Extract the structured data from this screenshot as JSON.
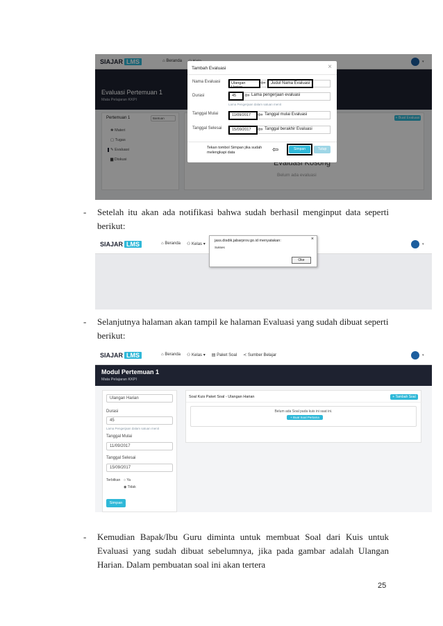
{
  "paragraphs": [
    "Setelah itu akan ada notifikasi bahwa sudah berhasil menginput data seperti berikut:",
    "Selanjutnya halaman akan tampil ke halaman Evaluasi yang sudah dibuat seperti berikut:",
    "Kemudian Bapak/Ibu Guru diminta untuk membuat Soal dari Kuis untuk Evaluasi yang sudah dibuat sebelumnya, jika pada gambar adalah Ulangan Harian. Dalam pembuatan soal ini akan tertera"
  ],
  "page_number": "25",
  "brand": {
    "name": "SIAJAR",
    "suffix": "LMS"
  },
  "shot1": {
    "nav": [
      "Beranda",
      "Kela"
    ],
    "header_title": "Evaluasi Pertemuan 1",
    "header_subtitle": "Mata Pelajaran KKPI",
    "sidebar_title": "Pertemuan 1",
    "sidebar_select": "Bantuan",
    "sidebar_items": [
      "Materi",
      "Tugas",
      "Evaluasi",
      "Diskusi"
    ],
    "add_button": "+ Buat Evaluasi",
    "empty_title": "Evaluasi Kosong",
    "empty_sub": "Belum ada evaluasi",
    "modal": {
      "title": "Tambah Evaluasi",
      "close": "×",
      "name_label": "Nama Evaluasi",
      "name_value": "Ulangan Harian",
      "name_note": "Judul Nama Evaluasi",
      "duration_label": "Durasi",
      "duration_value": "45",
      "duration_note": "Lama pengerjaan evaluasi",
      "duration_hint": "Lama Pengerjaan dalam satuan menit",
      "start_label": "Tanggal Mulai",
      "start_value": "11/09/2017",
      "start_note": "Tanggal mulai Evaluasi",
      "end_label": "Tanggal Selesai",
      "end_value": "15/09/2017",
      "end_note": "Tanggal berakhir Evaluasi",
      "save_note": "Tekan tombol Simpan jika sudah melengkapi data",
      "save": "Simpan",
      "close_btn": "Tutup"
    }
  },
  "shot2": {
    "nav": [
      "Beranda",
      "Kelas",
      "Pa"
    ],
    "dialog_title": "jass.disdik.jabarprov.go.id menyatakan:",
    "dialog_msg": "Sukses",
    "ok": "Oke",
    "close": "×"
  },
  "shot3": {
    "nav": [
      "Beranda",
      "Kelas",
      "Paket Soal",
      "Sumber Belajar"
    ],
    "header_title": "Modul Pertemuan 1",
    "header_subtitle": "Mata Pelajaran KKPI",
    "name_value": "Ulangan Harian",
    "duration_label": "Durasi",
    "duration_value": "45",
    "duration_hint": "Lama Pengerjaan dalam satuan menit",
    "start_label": "Tanggal Mulai",
    "start_value": "11/09/2017",
    "end_label": "Tanggal Selesai",
    "end_value": "15/09/2017",
    "publish_label": "Terbitkan",
    "opt_yes": "Ya",
    "opt_no": "Tidak",
    "save": "Simpan",
    "panel_title": "Soal Kuis Paket Soal - Ulangan Harian",
    "add_soal": "+ Tambah Soal",
    "empty_msg": "Belum ada Soal pada kuis ini saat ini.",
    "create_first": "+ Buat Soal Pertama"
  },
  "colors": {
    "accent": "#2fb8d8",
    "header": "#1e2230",
    "avatar": "#1c5e9e"
  }
}
